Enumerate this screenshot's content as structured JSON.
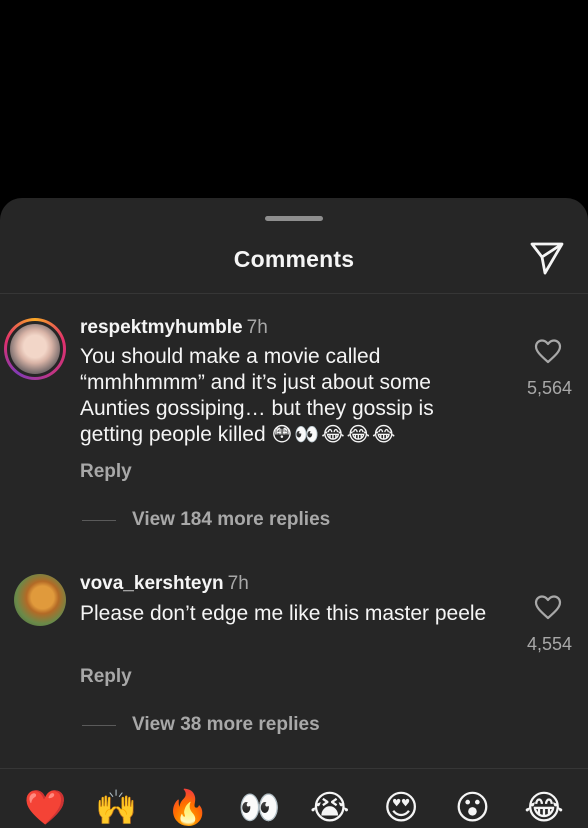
{
  "sheet": {
    "title": "Comments",
    "share_icon": "paper-plane-icon"
  },
  "comments": [
    {
      "username": "respektmyhumble",
      "time": "7h",
      "text": "You should make a movie called “mmhhmmm” and it’s just about some Aunties gossiping… but they gossip is getting people killed",
      "emojis": "😳👀😂😂😂",
      "likes": "5,564",
      "reply_label": "Reply",
      "view_replies": "View 184 more replies",
      "avatar_ring": true
    },
    {
      "username": "vova_kershteyn",
      "time": "7h",
      "text": "Please don’t edge me like this master peele",
      "emojis": "",
      "likes": "4,554",
      "reply_label": "Reply",
      "view_replies": "View 38 more replies",
      "avatar_ring": false
    }
  ],
  "emoji_bar": [
    "❤️",
    "🙌",
    "🔥",
    "👀",
    "😭",
    "😍",
    "😮",
    "😂"
  ],
  "icons": {
    "like": "heart-outline-icon",
    "share": "paper-plane-icon"
  },
  "colors": {
    "sheet_bg": "#262626",
    "secondary_text": "#a8a8a8",
    "primary_text": "#f5f5f5"
  }
}
